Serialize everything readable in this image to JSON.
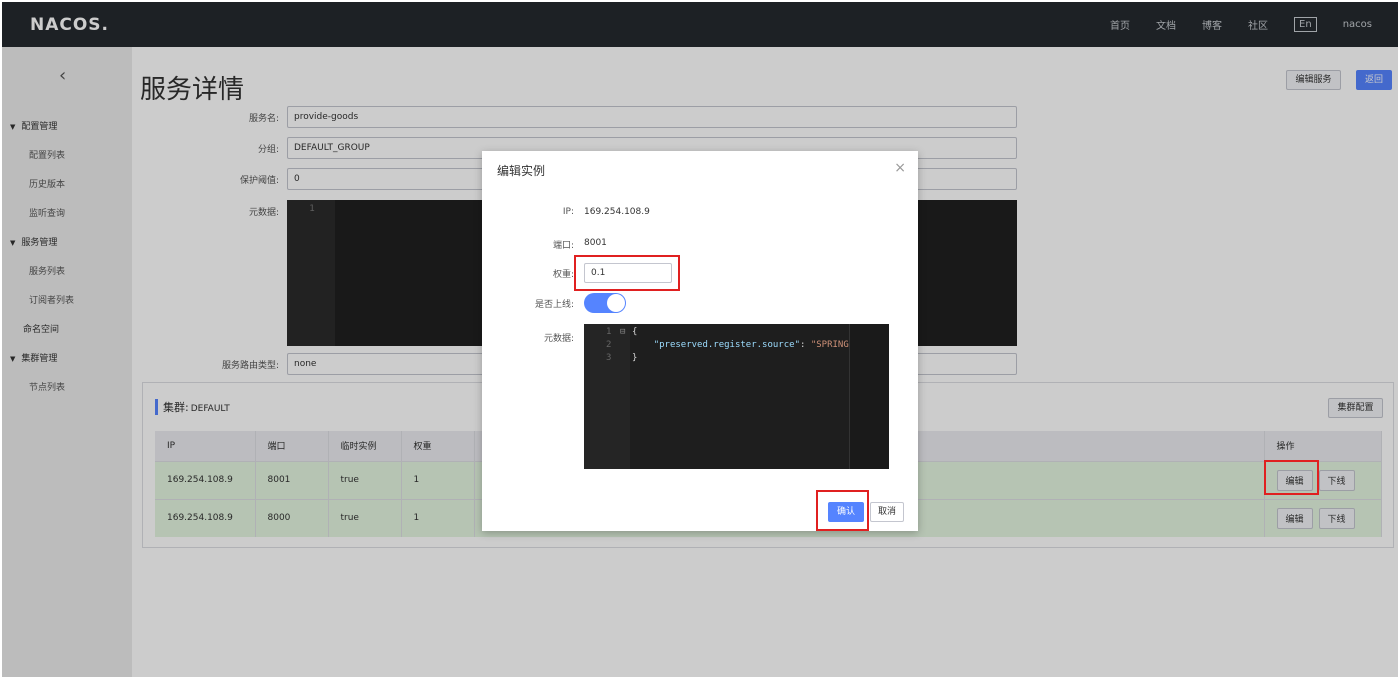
{
  "topbar": {
    "logo": "NACOS.",
    "nav": [
      "首页",
      "文档",
      "博客",
      "社区"
    ],
    "lang": "En",
    "user": "nacos"
  },
  "sidebar": {
    "groups": [
      {
        "label": "配置管理",
        "items": [
          "配置列表",
          "历史版本",
          "监听查询"
        ]
      },
      {
        "label": "服务管理",
        "items": [
          "服务列表",
          "订阅者列表"
        ]
      },
      {
        "top_item": "命名空间"
      },
      {
        "label": "集群管理",
        "items": [
          "节点列表"
        ]
      }
    ]
  },
  "page": {
    "title": "服务详情",
    "edit_service_btn": "编辑服务",
    "back_btn": "返回",
    "fields": {
      "service_name_label": "服务名:",
      "service_name": "provide-goods",
      "group_label": "分组:",
      "group": "DEFAULT_GROUP",
      "threshold_label": "保护阈值:",
      "threshold": "0",
      "metadata_label": "元数据:",
      "metadata_line": "1",
      "route_label": "服务路由类型:",
      "route": "none"
    }
  },
  "cluster": {
    "title": "集群:",
    "name": "DEFAULT",
    "config_btn": "集群配置",
    "columns": [
      "IP",
      "端口",
      "临时实例",
      "权重",
      "",
      "操作"
    ],
    "rows": [
      {
        "ip": "169.254.108.9",
        "port": "8001",
        "ephemeral": "true",
        "weight": "1",
        "edit": "编辑",
        "offline": "下线"
      },
      {
        "ip": "169.254.108.9",
        "port": "8000",
        "ephemeral": "true",
        "weight": "1",
        "edit": "编辑",
        "offline": "下线"
      }
    ]
  },
  "modal": {
    "title": "编辑实例",
    "close": "×",
    "ip_label": "IP:",
    "ip": "169.254.108.9",
    "port_label": "端口:",
    "port": "8001",
    "weight_label": "权重:",
    "weight": "0.1",
    "online_label": "是否上线:",
    "online": true,
    "metadata_label": "元数据:",
    "code": {
      "line1": "{",
      "line2_key": "\"preserved.register.source\"",
      "line2_sep": ": ",
      "line2_val": "\"SPRING",
      "line3": "}"
    },
    "confirm": "确认",
    "cancel": "取消"
  },
  "colors": {
    "accent": "#5584ff",
    "highlight": "#e02020",
    "topbar": "#252a2f"
  }
}
